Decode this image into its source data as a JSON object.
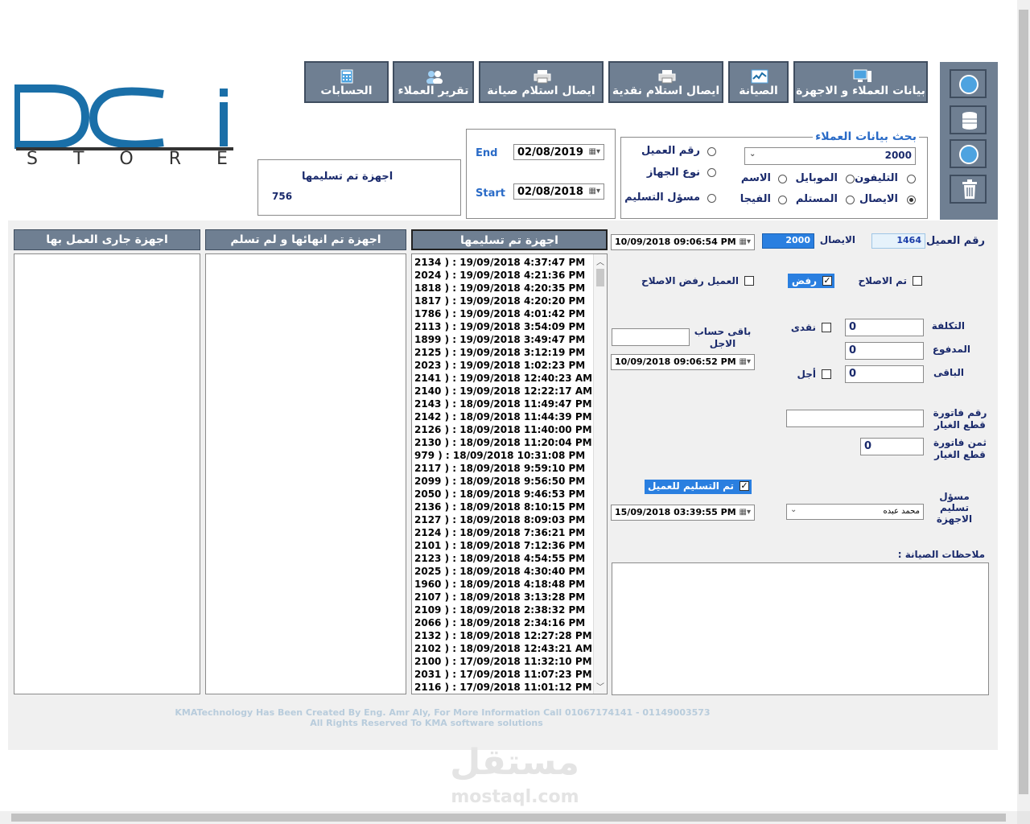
{
  "logo": {
    "main": "DCi",
    "sub": "STORE"
  },
  "toolbar": [
    {
      "label": "الحسابات",
      "icon": "calculator-icon"
    },
    {
      "label": "تقرير العملاء",
      "icon": "users-icon"
    },
    {
      "label": "ايصال استلام صيانة",
      "icon": "printer-icon"
    },
    {
      "label": "ايصال استلام نقدية",
      "icon": "printer-icon"
    },
    {
      "label": "الصيانة",
      "icon": "chart-icon"
    },
    {
      "label": "بيانات العملاء و الاجهزة",
      "icon": "computer-icon"
    }
  ],
  "side_buttons": [
    "power-icon",
    "database-icon",
    "refresh-icon",
    "trash-icon"
  ],
  "delivered_box": {
    "title": "اجهزة تم تسليمها",
    "count": "756"
  },
  "date_range": {
    "end_label": "End",
    "end_value": "02/08/2019",
    "start_label": "Start",
    "start_value": "02/08/2018"
  },
  "search": {
    "title": "بحث بيانات العملاء",
    "value": "2000",
    "options": [
      {
        "label": "رقم العميل",
        "checked": false
      },
      {
        "label": "نوع الجهاز",
        "checked": false
      },
      {
        "label": "مسؤل التسليم",
        "checked": false
      },
      {
        "label": "التليفون",
        "checked": false
      },
      {
        "label": "الموبايل",
        "checked": false
      },
      {
        "label": "الاسم",
        "checked": false
      },
      {
        "label": "الايصال",
        "checked": true
      },
      {
        "label": "المستلم",
        "checked": false
      },
      {
        "label": "الفيجا",
        "checked": false
      }
    ]
  },
  "columns": {
    "in_progress": "اجهزة جارى العمل بها",
    "finished": "اجهزة تم انهائها و لم تسلم",
    "delivered": "اجهزة تم تسليمها"
  },
  "delivered_list": [
    "2134 ) : 19/09/2018 4:37:47 PM",
    "2024 ) : 19/09/2018 4:21:36 PM",
    "1818 ) : 19/09/2018 4:20:35 PM",
    "1817 ) : 19/09/2018 4:20:20 PM",
    "1786 ) : 19/09/2018 4:01:42 PM",
    "2113 ) : 19/09/2018 3:54:09 PM",
    "1899 ) : 19/09/2018 3:49:47 PM",
    "2125 ) : 19/09/2018 3:12:19 PM",
    "2023 ) : 19/09/2018 1:02:23 PM",
    "2141 ) : 19/09/2018 12:40:23 AM",
    "2140 ) : 19/09/2018 12:22:17 AM",
    "2143 ) : 18/09/2018 11:49:47 PM",
    "2142 ) : 18/09/2018 11:44:39 PM",
    "2126 ) : 18/09/2018 11:40:00 PM",
    "2130 ) : 18/09/2018 11:20:04 PM",
    "979 ) : 18/09/2018 10:31:08 PM",
    "2117 ) : 18/09/2018 9:59:10 PM",
    "2099 ) : 18/09/2018 9:56:50 PM",
    "2050 ) : 18/09/2018 9:46:53 PM",
    "2136 ) : 18/09/2018 8:10:15 PM",
    "2127 ) : 18/09/2018 8:09:03 PM",
    "2124 ) : 18/09/2018 7:36:21 PM",
    "2101 ) : 18/09/2018 7:12:36 PM",
    "2123 ) : 18/09/2018 4:54:55 PM",
    "2025 ) : 18/09/2018 4:30:40 PM",
    "1960 ) : 18/09/2018 4:18:48 PM",
    "2107 ) : 18/09/2018 3:13:28 PM",
    "2109 ) : 18/09/2018 2:38:32 PM",
    "2066 ) : 18/09/2018 2:34:16 PM",
    "2132 ) : 18/09/2018 12:27:28 PM",
    "2102 ) : 18/09/2018 12:43:21 AM",
    "2100 ) : 17/09/2018 11:32:10 PM",
    "2031 ) : 17/09/2018 11:07:23 PM",
    "2116 ) : 17/09/2018 11:01:12 PM"
  ],
  "details": {
    "customer_no_label": "رقم العميل",
    "customer_no": "1464",
    "receipt_label": "الايصال",
    "receipt_no": "2000",
    "receipt_date": "10/09/2018  09:06:54 PM",
    "repaired_label": "تم الاصلاح",
    "repaired": false,
    "refused_label": "رفض",
    "refused": true,
    "customer_refused_label": "العميل رفض الاصلاح",
    "customer_refused": false,
    "cost_label": "التكلفة",
    "cost": "0",
    "cash_label": "نقدى",
    "cash": false,
    "paid_label": "المدفوع",
    "paid": "0",
    "remaining_label": "الباقى",
    "remaining": "0",
    "deferred_label": "أجل",
    "deferred": false,
    "deferred_balance_label": "باقى حساب الاجل",
    "deferred_balance": "",
    "deferred_date": "10/09/2018  09:06:52 PM",
    "parts_invoice_no_label": "رقم فاتورة قطع الغيار",
    "parts_invoice_no": "",
    "parts_invoice_price_label": "ثمن فاتورة قطع الغيار",
    "parts_invoice_price": "0",
    "delivered_label": "تم التسليم للعميل",
    "delivered": true,
    "delivery_date": "15/09/2018  03:39:55 PM",
    "delivery_person_label": "مسؤل تسليم الاجهزة",
    "delivery_person": "محمد عبده",
    "notes_label": "ملاحظات الصيانة :",
    "notes": ""
  },
  "footer": {
    "line1": "KMATechnology Has Been Created By Eng. Amr Aly, For More Information Call 01067174141 - 01149003573",
    "line2": "All Rights Reserved To KMA software solutions"
  },
  "watermark": {
    "arabic": "مستقل",
    "latin": "mostaql.com"
  }
}
